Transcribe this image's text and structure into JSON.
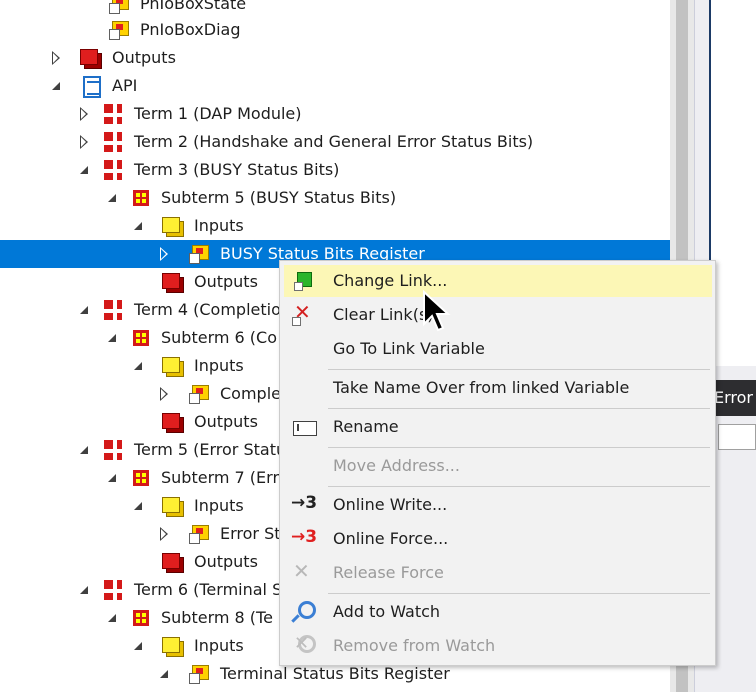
{
  "tree": {
    "rows": [
      {
        "label": "PnIoBoxState",
        "icon": "variable-icon",
        "arrow": "none"
      },
      {
        "label": "PnIoBoxDiag",
        "icon": "variable-icon",
        "arrow": "none"
      },
      {
        "label": "Outputs",
        "icon": "outputs-icon",
        "arrow": "collapsed"
      },
      {
        "label": "API",
        "icon": "api-icon",
        "arrow": "expanded"
      },
      {
        "label": "Term 1 (DAP Module)",
        "icon": "term-icon",
        "arrow": "collapsed"
      },
      {
        "label": "Term 2 (Handshake and General Error Status Bits)",
        "icon": "term-icon",
        "arrow": "collapsed"
      },
      {
        "label": "Term 3 (BUSY Status Bits)",
        "icon": "term-icon",
        "arrow": "expanded"
      },
      {
        "label": "Subterm 5 (BUSY Status Bits)",
        "icon": "subterm-icon",
        "arrow": "expanded"
      },
      {
        "label": "Inputs",
        "icon": "inputs-icon",
        "arrow": "expanded"
      },
      {
        "label": "BUSY Status Bits Register",
        "icon": "variable-icon",
        "arrow": "collapsed",
        "selected": true
      },
      {
        "label": "Outputs",
        "icon": "outputs-icon",
        "arrow": "none"
      },
      {
        "label": "Term 4 (Completio",
        "icon": "term-icon",
        "arrow": "expanded"
      },
      {
        "label": "Subterm 6 (Co",
        "icon": "subterm-icon",
        "arrow": "expanded"
      },
      {
        "label": "Inputs",
        "icon": "inputs-icon",
        "arrow": "expanded"
      },
      {
        "label": "Comple",
        "icon": "variable-icon",
        "arrow": "collapsed"
      },
      {
        "label": "Outputs",
        "icon": "outputs-icon",
        "arrow": "none"
      },
      {
        "label": "Term 5 (Error Statu",
        "icon": "term-icon",
        "arrow": "expanded"
      },
      {
        "label": "Subterm 7 (Err",
        "icon": "subterm-icon",
        "arrow": "expanded"
      },
      {
        "label": "Inputs",
        "icon": "inputs-icon",
        "arrow": "expanded"
      },
      {
        "label": "Error St",
        "icon": "variable-icon",
        "arrow": "collapsed"
      },
      {
        "label": "Outputs",
        "icon": "outputs-icon",
        "arrow": "none"
      },
      {
        "label": "Term 6 (Terminal S",
        "icon": "term-icon",
        "arrow": "expanded"
      },
      {
        "label": "Subterm 8 (Te",
        "icon": "subterm-icon",
        "arrow": "expanded"
      },
      {
        "label": "Inputs",
        "icon": "inputs-icon",
        "arrow": "expanded"
      },
      {
        "label": "Terminal Status Bits Register",
        "icon": "variable-icon",
        "arrow": "expanded"
      }
    ]
  },
  "right_pane": {
    "error_header": "Error"
  },
  "context_menu": {
    "items": [
      {
        "label": "Change Link...",
        "icon": "change-link-icon",
        "enabled": true,
        "highlighted": true
      },
      {
        "label": "Clear Link(s)",
        "icon": "clear-link-icon",
        "enabled": true
      },
      {
        "label": "Go To Link Variable",
        "icon": "",
        "enabled": true
      },
      {
        "label": "Take Name Over from linked Variable",
        "icon": "",
        "enabled": true
      },
      {
        "label": "Rename",
        "icon": "rename-icon",
        "enabled": true
      },
      {
        "label": "Move Address...",
        "icon": "",
        "enabled": false
      },
      {
        "label": "Online Write...",
        "icon": "online-write-icon",
        "enabled": true
      },
      {
        "label": "Online Force...",
        "icon": "online-force-icon",
        "enabled": true
      },
      {
        "label": "Release Force",
        "icon": "release-force-icon",
        "enabled": false
      },
      {
        "label": "Add to Watch",
        "icon": "add-watch-icon",
        "enabled": true
      },
      {
        "label": "Remove from Watch",
        "icon": "remove-watch-icon",
        "enabled": false
      }
    ],
    "online_write_glyph": "→3",
    "online_force_glyph": "→3"
  }
}
